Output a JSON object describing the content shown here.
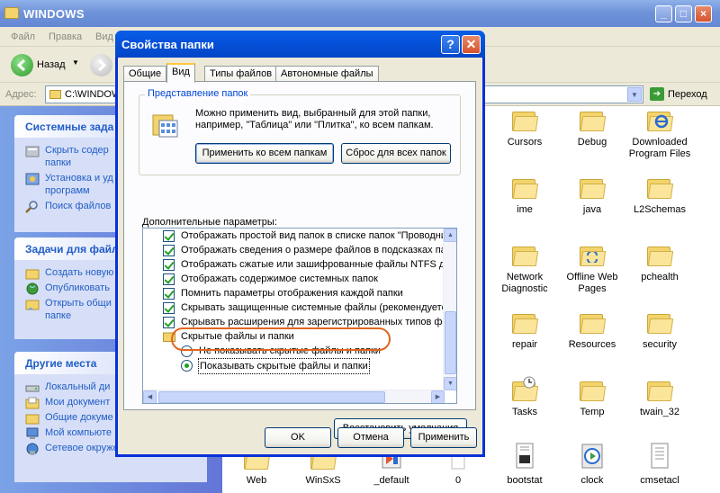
{
  "explorer": {
    "title": "WINDOWS",
    "menu": [
      "Файл",
      "Правка",
      "Вид"
    ],
    "back_label": "Назад",
    "address_label": "Адрес:",
    "address_value": "C:\\WINDOWS",
    "go_label": "Переход"
  },
  "taskpane": {
    "system": {
      "title": "Системные зада",
      "items": [
        "Скрыть содер",
        "папки",
        "Установка и уд",
        "программ",
        "Поиск файлов"
      ]
    },
    "file_tasks": {
      "title": "Задачи для файл",
      "items": [
        "Создать новую",
        "Опубликовать",
        "Открыть общи",
        "папке"
      ]
    },
    "places": {
      "title": "Другие места",
      "items": [
        "Локальный ди",
        "Мои документ",
        "Общие докуме",
        "Мой компьюте",
        "Сетевое окружение"
      ]
    }
  },
  "files": [
    {
      "name": "Cursors"
    },
    {
      "name": "Debug"
    },
    {
      "name": "Downloaded Program Files"
    },
    {
      "name": "ime"
    },
    {
      "name": "java"
    },
    {
      "name": "L2Schemas"
    },
    {
      "name": "Network Diagnostic"
    },
    {
      "name": "Offline Web Pages"
    },
    {
      "name": "pchealth"
    },
    {
      "name": "repair"
    },
    {
      "name": "Resources"
    },
    {
      "name": "security"
    },
    {
      "name": "Tasks"
    },
    {
      "name": "Temp"
    },
    {
      "name": "twain_32"
    },
    {
      "name": "Web"
    },
    {
      "name": "WinSxS"
    },
    {
      "name": "_default"
    },
    {
      "name": "0"
    },
    {
      "name": "bootstat"
    },
    {
      "name": "clock"
    },
    {
      "name": "cmsetacl"
    }
  ],
  "dialog": {
    "title": "Свойства папки",
    "tabs": [
      "Общие",
      "Вид",
      "Типы файлов",
      "Автономные файлы"
    ],
    "group_label": "Представление папок",
    "group_text": "Можно применить вид, выбранный для этой папки, например, \"Таблица\" или \"Плитка\", ко всем папкам.",
    "apply_all_button": "Применить ко всем папкам",
    "reset_all_button": "Сброс для всех папок",
    "advanced_label": "Дополнительные параметры:",
    "options": [
      "Отображать простой вид папок в списке папок \"Проводни",
      "Отображать сведения о размере файлов в подсказках па",
      "Отображать сжатые или зашифрованные файлы NTFS др",
      "Отображать содержимое системных папок",
      "Помнить параметры отображения каждой папки",
      "Скрывать защищенные системные файлы (рекомендуетс",
      "Скрывать расширения для зарегистрированных типов фа"
    ],
    "hidden_folder_label": "Скрытые файлы и папки",
    "radio_dont_show": "Не показывать скрытые файлы и папки",
    "radio_show": "Показывать скрытые файлы и папки",
    "restore_button": "Восстановить умолчания",
    "ok_button": "OK",
    "cancel_button": "Отмена",
    "apply_button": "Применить",
    "help_glyph": "?",
    "close_glyph": "✕"
  }
}
